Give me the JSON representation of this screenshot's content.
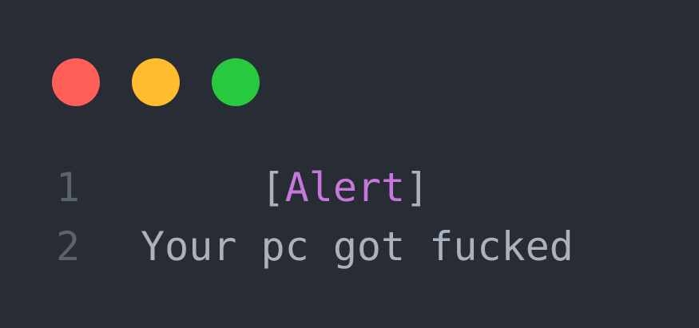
{
  "window": {
    "controls": [
      {
        "name": "close",
        "color": "#ff5f56"
      },
      {
        "name": "minimize",
        "color": "#ffbd2e"
      },
      {
        "name": "maximize",
        "color": "#27c93f"
      }
    ]
  },
  "editor": {
    "lines": [
      {
        "number": "1",
        "indent": "     ",
        "open": "[",
        "keyword": "Alert",
        "close": "]"
      },
      {
        "number": "2",
        "text": "Your pc got fucked"
      }
    ]
  }
}
